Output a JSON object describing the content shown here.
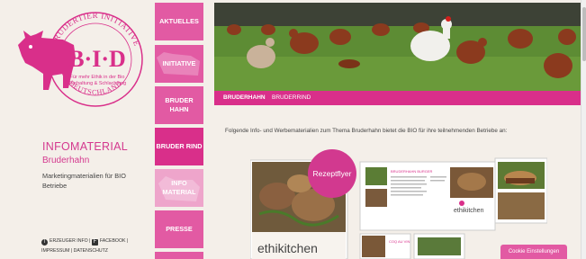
{
  "logo": {
    "arc_top": "BRUDERTIER INITIATIVE",
    "initials": "B·I·D",
    "tagline_1": "Für mehr Ethik in der Bio",
    "tagline_2": "Tierhaltung & Schlachtung",
    "arc_bottom": "DEUTSCHLAND"
  },
  "sidebar": {
    "title": "INFOMATERIAL",
    "subtitle": "Bruderhahn",
    "description": "Marketingmaterialien für BIO Betriebe",
    "footer": {
      "erzeuger": "ERZEUGER INFO",
      "facebook": "FACEBOOK",
      "impressum": "IMPRESSUM",
      "datenschutz": "DATENSCHUTZ"
    }
  },
  "nav": {
    "items": [
      {
        "label": "AKTUELLES"
      },
      {
        "label": "INITIATIVE"
      },
      {
        "label": "BRUDER HAHN"
      },
      {
        "label": "BRUDER RIND"
      },
      {
        "label": "INFO MATERIAL"
      },
      {
        "label": "PRESSE"
      }
    ]
  },
  "subnav": {
    "items": [
      "BRUDERHAHN",
      "BRUDERRIND"
    ]
  },
  "main": {
    "intro": "Folgende Info- und Werbematerialien zum Thema Bruderhahn bietet die BIO für ihre teilnehmenden Betriebe an:",
    "badge": "Rezeptflyer",
    "brand_large": "ethikitchen",
    "brand_small": "ethikitchen",
    "flyer_heading": "BRUDERHAHN BURGER",
    "coq": "COQ AU VIN"
  },
  "cookie": {
    "label": "Cookie Einstellungen"
  },
  "colors": {
    "brand_pink": "#d92f8a",
    "nav_pink": "#e25aa3",
    "background": "#f4efe9"
  }
}
